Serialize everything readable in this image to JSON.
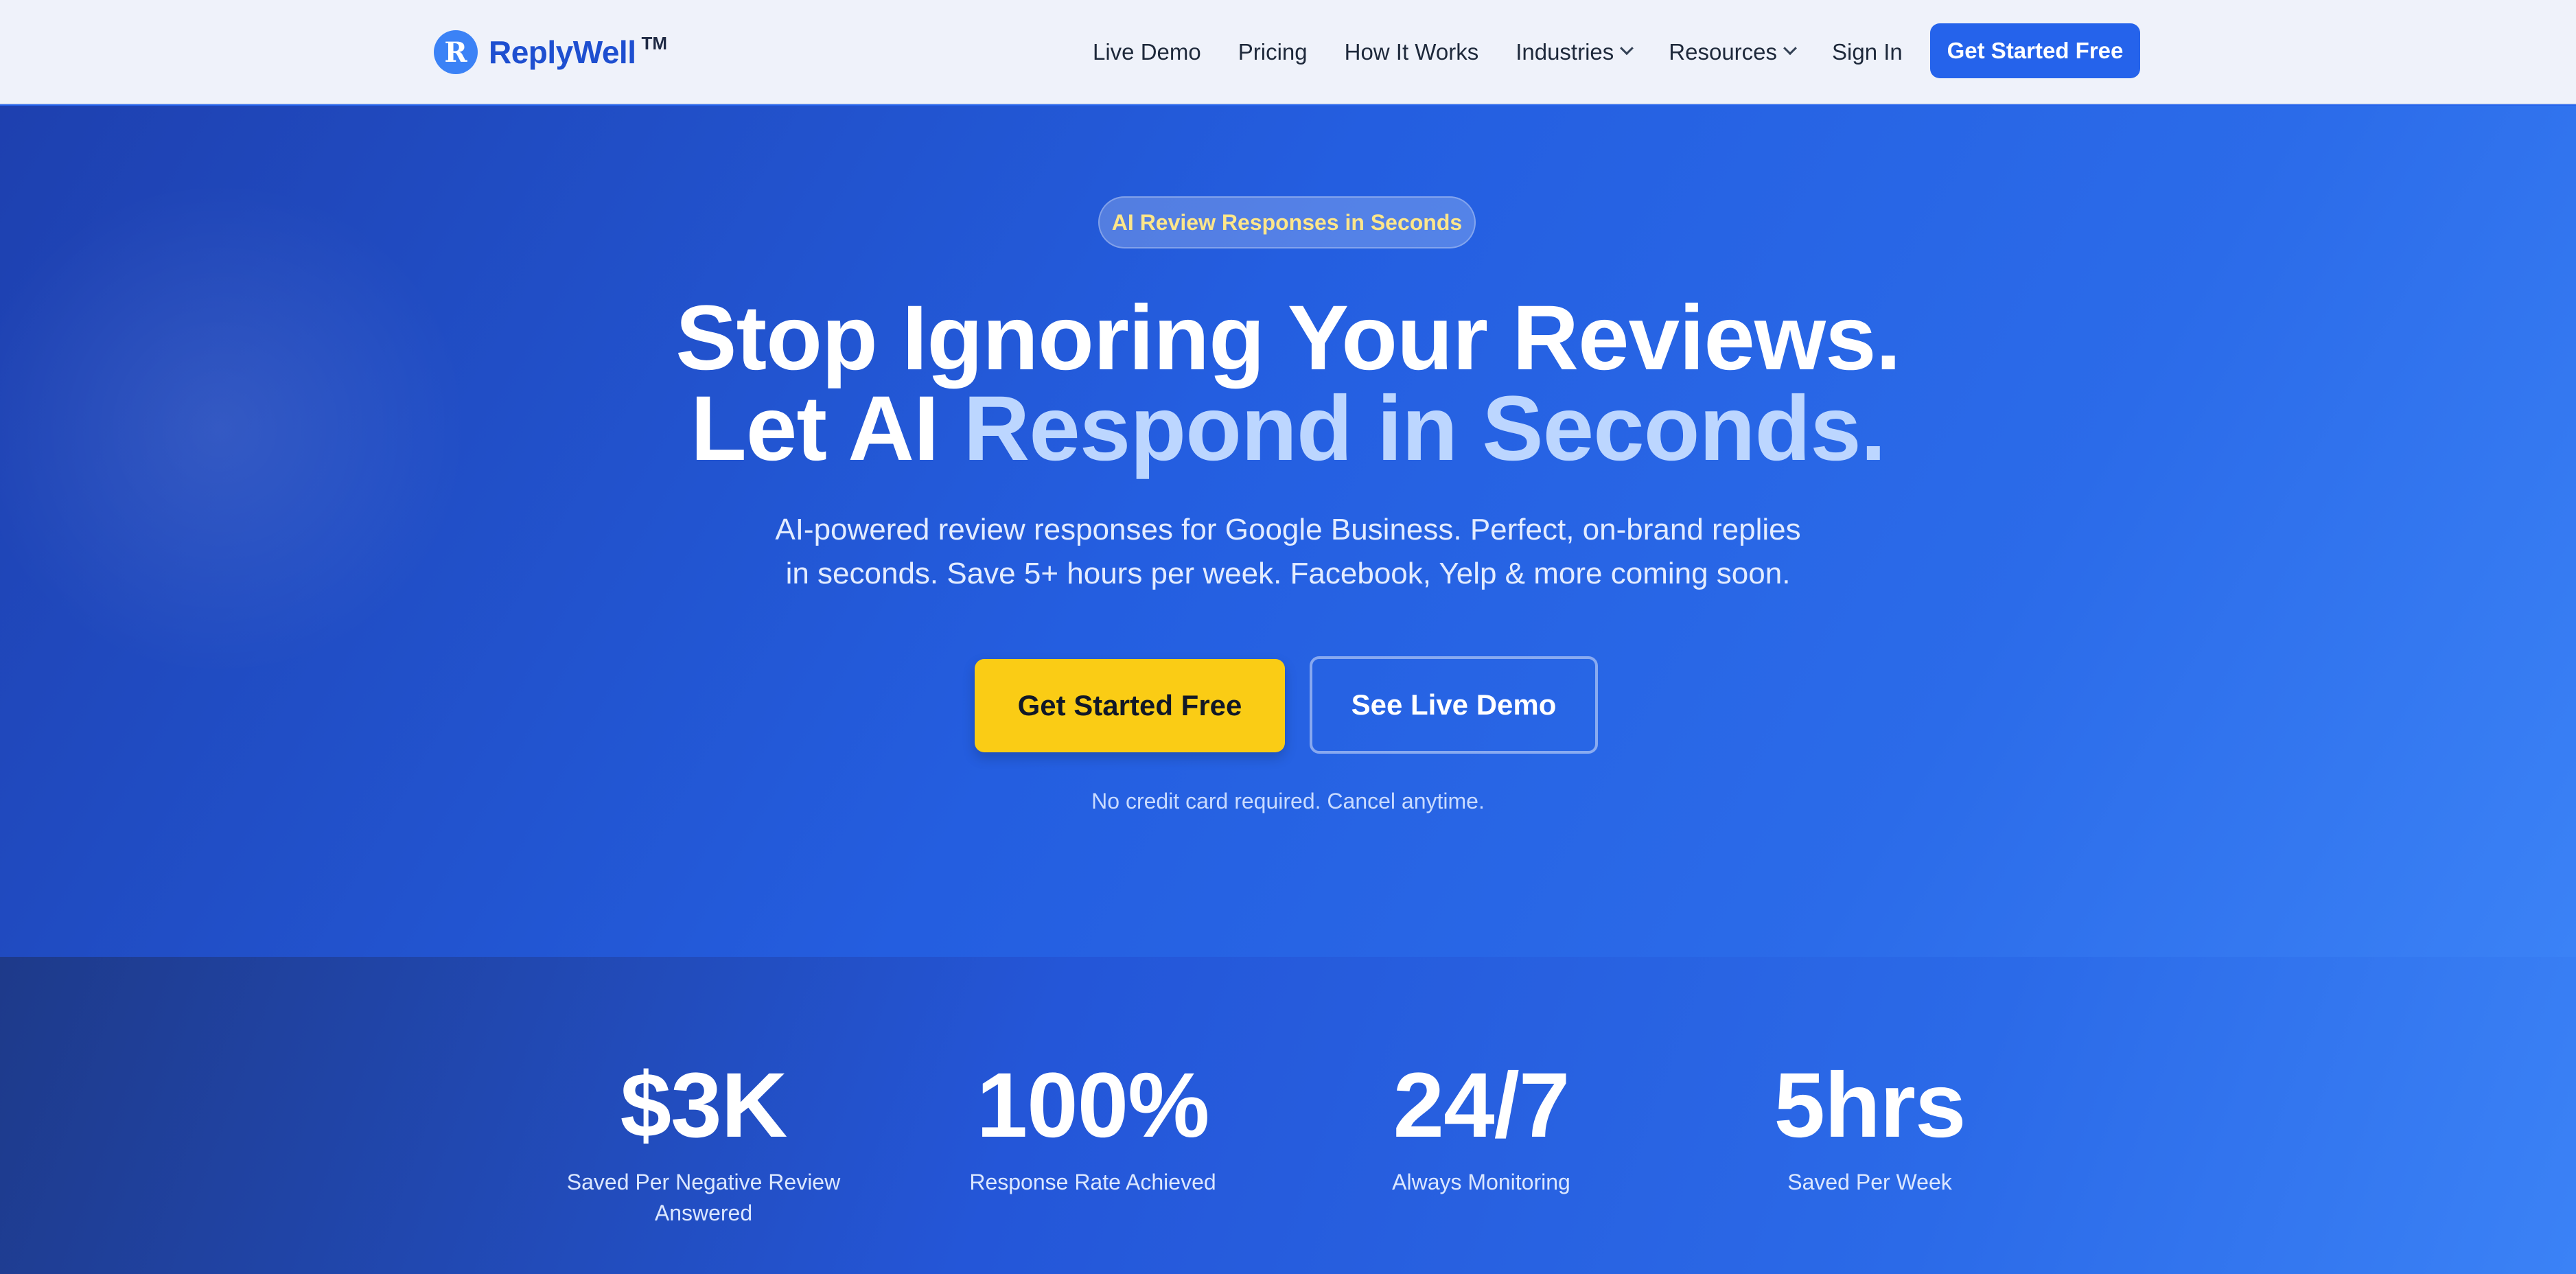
{
  "brand": {
    "logo_letter": "R",
    "name": "ReplyWell",
    "trademark": "TM"
  },
  "nav": {
    "items": [
      {
        "label": "Live Demo",
        "dropdown": false
      },
      {
        "label": "Pricing",
        "dropdown": false
      },
      {
        "label": "How It Works",
        "dropdown": false
      },
      {
        "label": "Industries",
        "dropdown": true
      },
      {
        "label": "Resources",
        "dropdown": true
      },
      {
        "label": "Sign In",
        "dropdown": false
      }
    ],
    "cta_label": "Get Started Free"
  },
  "hero": {
    "badge": "AI Review Responses in Seconds",
    "headline_line1": "Stop Ignoring Your Reviews.",
    "headline_line2_prefix": "Let AI ",
    "headline_line2_accent": "Respond in Seconds.",
    "subtitle_line1": "AI-powered review responses for Google Business. Perfect, on-brand replies",
    "subtitle_line2": "in seconds. Save 5+ hours per week. Facebook, Yelp & more coming soon.",
    "primary_button": "Get Started Free",
    "secondary_button": "See Live Demo",
    "note": "No credit card required. Cancel anytime."
  },
  "stats": [
    {
      "value": "$3K",
      "label_line1": "Saved Per Negative Review",
      "label_line2": "Answered"
    },
    {
      "value": "100%",
      "label_line1": "Response Rate Achieved",
      "label_line2": ""
    },
    {
      "value": "24/7",
      "label_line1": "Always Monitoring",
      "label_line2": ""
    },
    {
      "value": "5hrs",
      "label_line1": "Saved Per Week",
      "label_line2": ""
    }
  ],
  "colors": {
    "primary_blue": "#2563eb",
    "accent_yellow": "#facc15",
    "headline_accent": "#bcd6ff",
    "badge_text": "#fde68a"
  }
}
